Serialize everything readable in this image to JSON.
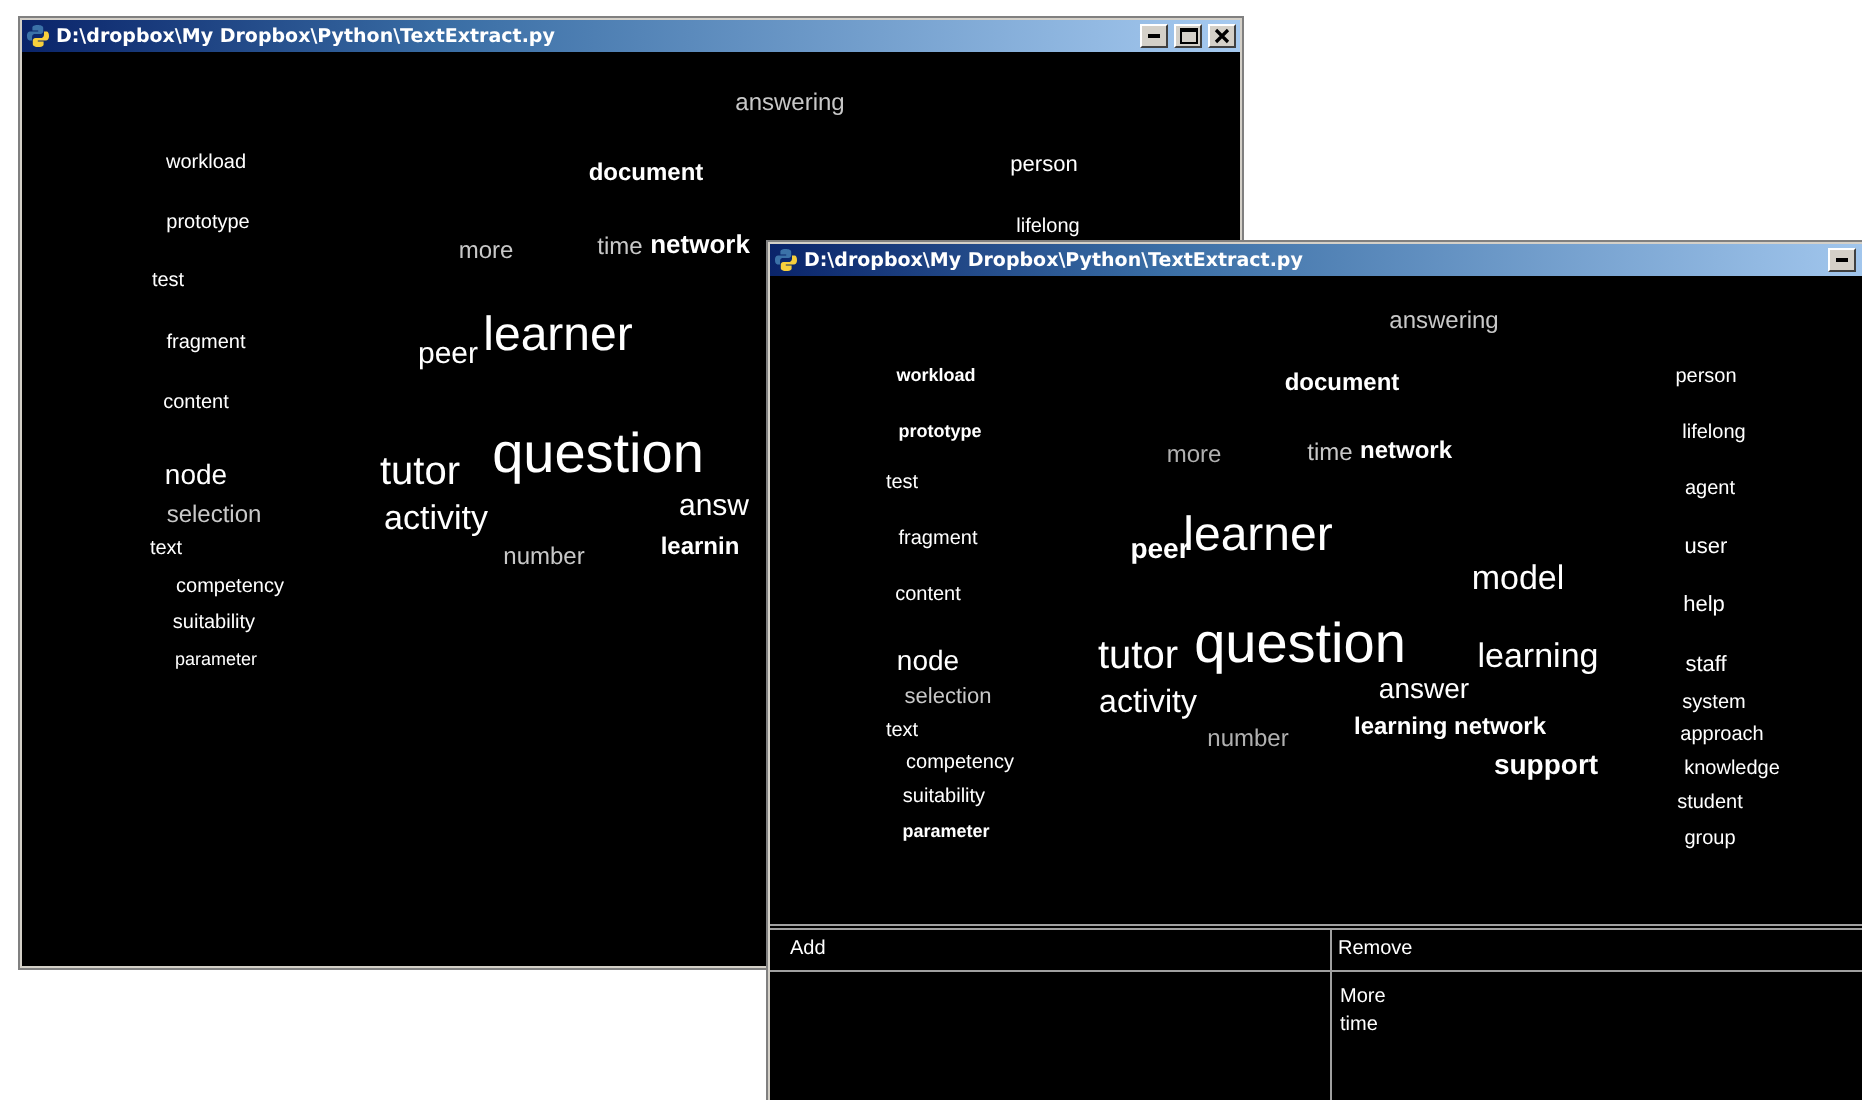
{
  "windows": [
    {
      "title": "D:\\dropbox\\My Dropbox\\Python\\TextExtract.py",
      "words": [
        "answering",
        "workload",
        "document",
        "person",
        "prototype",
        "lifelong",
        "more",
        "time",
        "network",
        "test",
        "fragment",
        "peer",
        "learner",
        "content",
        "node",
        "tutor",
        "question",
        "selection",
        "activity",
        "answ",
        "text",
        "number",
        "learnin",
        "competency",
        "suitability",
        "parameter"
      ]
    },
    {
      "title": "D:\\dropbox\\My Dropbox\\Python\\TextExtract.py",
      "words": [
        "answering",
        "workload",
        "document",
        "person",
        "prototype",
        "lifelong",
        "more",
        "time",
        "network",
        "test",
        "agent",
        "fragment",
        "peer",
        "learner",
        "user",
        "model",
        "content",
        "help",
        "node",
        "tutor",
        "question",
        "learning",
        "staff",
        "selection",
        "activity",
        "answer",
        "system",
        "text",
        "number",
        "learning network",
        "approach",
        "competency",
        "support",
        "knowledge",
        "suitability",
        "student",
        "parameter",
        "group"
      ],
      "add_panel": {
        "header": "Add"
      },
      "remove_panel": {
        "header": "Remove",
        "items": [
          "More",
          "time"
        ]
      }
    }
  ]
}
